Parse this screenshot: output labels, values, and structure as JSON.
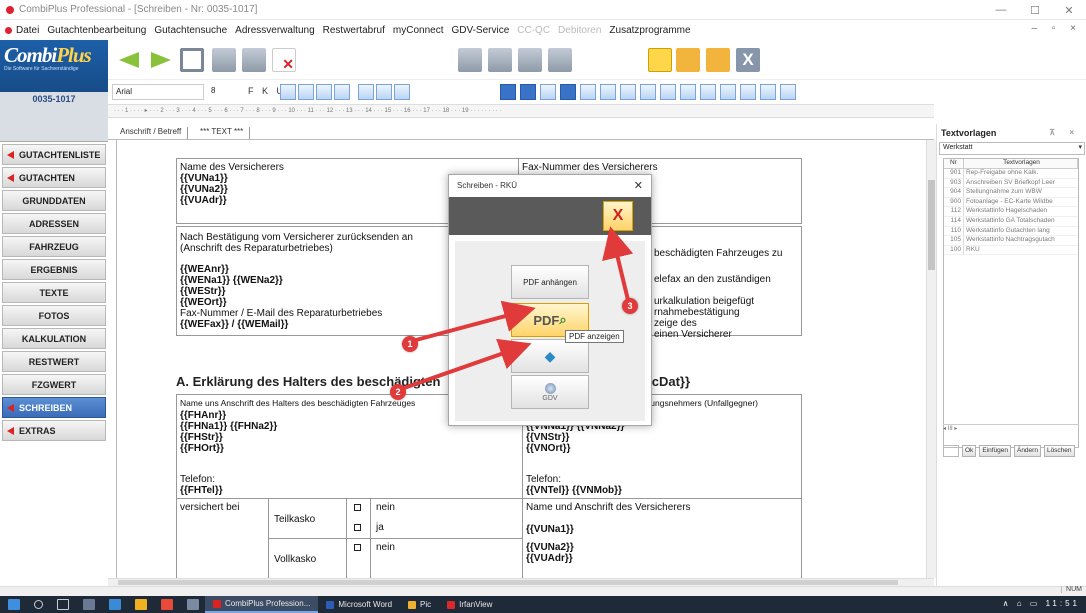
{
  "window": {
    "title": "CombiPlus Professional - [Schreiben - Nr: 0035-1017]",
    "controls": [
      "—",
      "☐",
      "✕"
    ]
  },
  "menu": {
    "items": [
      "Datei",
      "Gutachtenbearbeitung",
      "Gutachtensuche",
      "Adressverwaltung",
      "Restwertabruf",
      "myConnect",
      "GDV-Service",
      "CC-QC",
      "Debitoren",
      "Zusatzprogramme"
    ],
    "mdi_controls": "– ▫ ×"
  },
  "sidebar": {
    "brand_part1": "Combi",
    "brand_part2": "Plus",
    "slogan": "Die Software für Sachverständige",
    "case_number": "0035-1017",
    "items": [
      {
        "label": "GUTACHTENLISTE"
      },
      {
        "label": "GUTACHTEN"
      },
      {
        "label": "GRUNDDATEN"
      },
      {
        "label": "ADRESSEN"
      },
      {
        "label": "FAHRZEUG"
      },
      {
        "label": "ERGEBNIS"
      },
      {
        "label": "TEXTE"
      },
      {
        "label": "FOTOS"
      },
      {
        "label": "KALKULATION"
      },
      {
        "label": "RESTWERT"
      },
      {
        "label": "FZGWERT"
      },
      {
        "label": "SCHREIBEN"
      },
      {
        "label": "EXTRAS"
      }
    ]
  },
  "format_bar": {
    "font": "Arial",
    "size": "8",
    "format_glyphs": "F K U"
  },
  "doc_tabs": [
    "Anschrift / Betreff",
    "*** TEXT ***"
  ],
  "document": {
    "insurer_label": "Name des Versicherers",
    "insurer_fields": [
      "{{VUNa1}}",
      "{{VUNa2}}",
      "{{VUAdr}}"
    ],
    "fax_label": "Fax-Nummer des Versicherers",
    "return_line1": "Nach Bestätigung vom Versicherer zurücksenden an",
    "return_line2": "(Anschrift des Reparaturbetriebes)",
    "workshop_fields": [
      "{{WEAnr}}",
      "{{WENa1}} {{WENa2}}",
      "{{WEStr}}",
      "{{WEOrt}}"
    ],
    "workshop_contact_label": "Fax-Nummer / E-Mail des Reparaturbetriebes",
    "workshop_contact": "{{WEFax}} / {{WEMail}}",
    "right_text": [
      "beschädigten Fahrzeuges zu",
      "elefax an den zuständigen",
      "urkalkulation beigefügt",
      "rnahmebestätigung",
      "zeige des",
      "einen Versicherer"
    ],
    "section_heading": "A. Erklärung des Halters des beschädigten",
    "section_heading_right": "{ScDat}}",
    "holder_label": "Name uns Anschrift des Halters des beschädigten Fahrzeuges",
    "holder_fields": [
      "{{FHAnr}}",
      "{{FHNa1}} {{FHNa2}}",
      "{{FHStr}}",
      "{{FHOrt}}"
    ],
    "phone_label": "Telefon:",
    "holder_phone": "{{FHTel}}",
    "opponent_label": "herungsnehmers (Unfallgegner)",
    "opponent_fields": [
      "{{VNNa1}} {{VNNa2}}",
      "{{VNStr}}",
      "{{VNOrt}}"
    ],
    "opponent_phone": "{{VNTel}} {{VNMob}}",
    "insured_at": "versichert bei",
    "teilkasko": "Teilkasko",
    "vollkasko": "Vollkasko",
    "nein": "nein",
    "ja": "ja",
    "insurer2_label": "Name und Anschrift des Versicherers",
    "insurer2_fields": [
      "{{VUNa1}}",
      "{{VUNa2}}",
      "{{VUAdr}}"
    ]
  },
  "dialog": {
    "title": "Schreiben - RKÜ",
    "close_glyph": "✕",
    "exit_glyph": "X",
    "attach_label": "PDF anhängen",
    "pdf_label": "PDF",
    "gdv_label": "GDV",
    "tooltip": "PDF anzeigen"
  },
  "callouts": [
    "1",
    "2",
    "3"
  ],
  "right_panel": {
    "title": "Textvorlagen",
    "pin": "⊼ ×",
    "filter": "Werkstatt",
    "col_nr": "Nr",
    "col_name": "Textvorlagen",
    "rows": [
      {
        "nr": "901",
        "name": "Rep-Freigabe ohne Kalk."
      },
      {
        "nr": "903",
        "name": "Anschreiben SV Briefkopf Leer"
      },
      {
        "nr": "904",
        "name": "Stellungnahme zum WBW"
      },
      {
        "nr": "900",
        "name": "Fotoanlage - EC-Karte Wildbe"
      },
      {
        "nr": "112",
        "name": "Werkstattinfo Hagelschaden"
      },
      {
        "nr": "114",
        "name": "Werkstattinfo GA Totalschaden"
      },
      {
        "nr": "110",
        "name": "Werkstattinfo Gutachten lang"
      },
      {
        "nr": "105",
        "name": "Werkstattinfo Nachtragsgutach"
      },
      {
        "nr": "100",
        "name": "RKÜ"
      }
    ],
    "hscroll_glyph": "◂   III   ▸",
    "buttons": [
      "Ok",
      "Einfügen",
      "Ändern",
      "Löschen"
    ]
  },
  "statusbar": {
    "num": "NUM"
  },
  "taskbar": {
    "apps": [
      {
        "label": "CombiPlus Profession..."
      },
      {
        "label": "Microsoft Word"
      },
      {
        "label": "Pic"
      },
      {
        "label": "IrfanView"
      }
    ],
    "tray": "∧ ⌂ ▭ 11:51"
  }
}
